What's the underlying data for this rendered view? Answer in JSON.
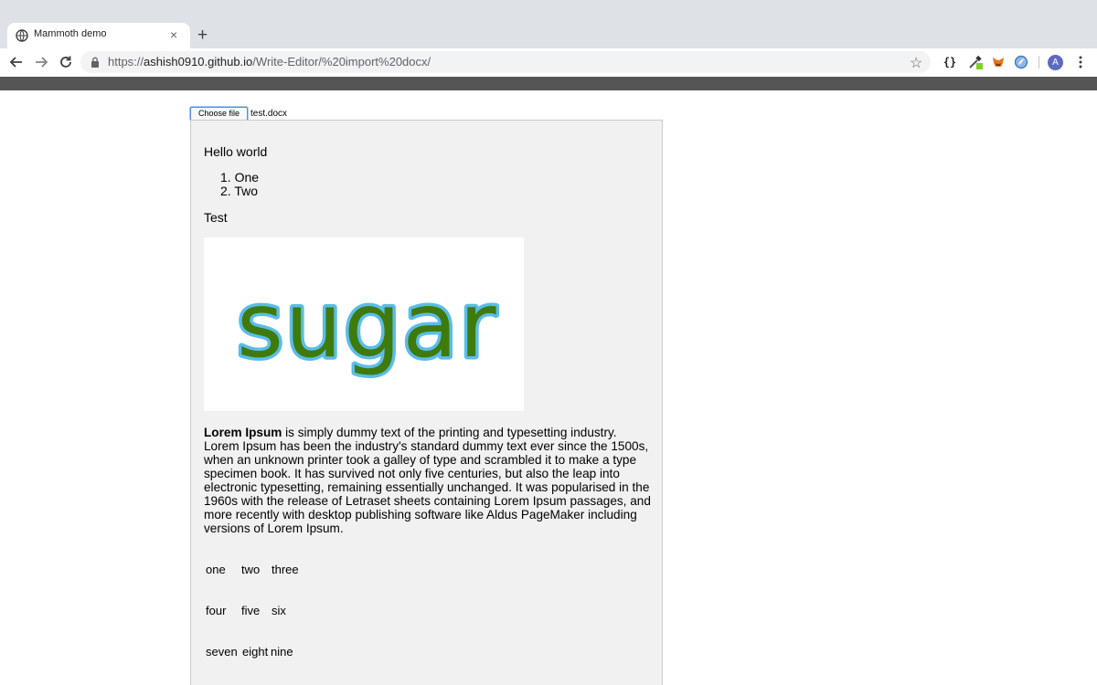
{
  "browser": {
    "tab": {
      "title": "Mammoth demo",
      "close": "×"
    },
    "new_tab": "+",
    "url": {
      "scheme": "https://",
      "host": "ashish0910.github.io",
      "path": "/Write-Editor/%20import%20docx/"
    },
    "json_ext_label": "{}",
    "avatar_letter": "A",
    "icons": [
      "globe-icon",
      "close-icon",
      "plus-icon",
      "back-arrow-icon",
      "forward-arrow-icon",
      "reload-icon",
      "lock-icon",
      "star-icon",
      "json-viewer-icon",
      "eyedropper-icon",
      "metamask-fox-icon",
      "extension-icon",
      "kebab-menu-icon"
    ]
  },
  "file_input": {
    "button": "Choose file",
    "file_name": "test.docx"
  },
  "document": {
    "heading": "Hello world",
    "list": [
      "One",
      "Two"
    ],
    "test": "Test",
    "image_word": "sugar",
    "lorem_bold": "Lorem Ipsum",
    "lorem_rest": " is simply dummy text of the printing and typesetting industry. Lorem Ipsum has been the industry's standard dummy text ever since the 1500s, when an unknown printer took a galley of type and scrambled it to make a type specimen book. It has survived not only five centuries, but also the leap into electronic typesetting, remaining essentially unchanged. It was popularised in the 1960s with the release of Letraset sheets containing Lorem Ipsum passages, and more recently with desktop publishing software like Aldus PageMaker including versions of Lorem Ipsum.",
    "table": [
      [
        "one",
        "two",
        "three"
      ],
      [
        "four",
        "five",
        "six"
      ],
      [
        "seven",
        "eight",
        "nine"
      ]
    ]
  },
  "colors": {
    "image_text_fill": "#3f7a0c",
    "image_text_stroke": "#5bbde8",
    "avatar": "#5c6bc0"
  }
}
